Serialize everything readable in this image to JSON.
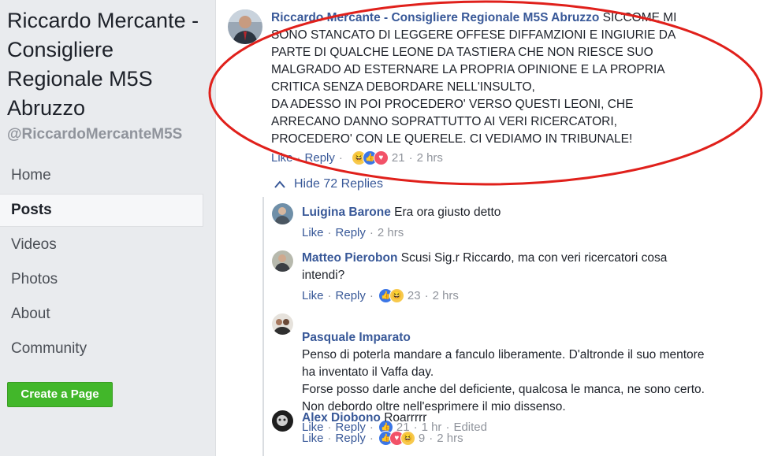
{
  "sidebar": {
    "page_name": "Riccardo Mercante - Consigliere Regionale M5S Abruzzo",
    "handle": "@RiccardoMercanteM5S",
    "nav": [
      "Home",
      "Posts",
      "Videos",
      "Photos",
      "About",
      "Community"
    ],
    "active_nav": "Posts",
    "create_page_label": "Create a Page"
  },
  "main_comment": {
    "author": "Riccardo Mercante - Consigliere Regionale M5S Abruzzo",
    "text_lines": [
      "SICCOME MI",
      "SONO STANCATO DI LEGGERE OFFESE DIFFAMZIONI E INGIURIE DA",
      "PARTE DI QUALCHE LEONE DA TASTIERA CHE NON RIESCE SUO",
      "MALGRADO AD ESTERNARE LA PROPRIA OPINIONE E LA PROPRIA",
      "CRITICA SENZA DEBORDARE NELL'INSULTO,",
      "DA ADESSO IN POI PROCEDERO' VERSO QUESTI LEONI, CHE",
      "ARRECANO DANNO SOPRATTUTTO AI VERI RICERCATORI,",
      "PROCEDERO' CON LE QUERELE. CI VEDIAMO IN TRIBUNALE!"
    ],
    "like_label": "Like",
    "reply_label": "Reply",
    "reactions": [
      "haha",
      "like",
      "love"
    ],
    "reaction_count": "21",
    "time": "2 hrs"
  },
  "hide_replies_label": "Hide 72 Replies",
  "replies": [
    {
      "author": "Luigina Barone",
      "text": "Era ora giusto detto",
      "like_label": "Like",
      "reply_label": "Reply",
      "reactions": [],
      "reaction_count": "",
      "time": "2 hrs",
      "edited": ""
    },
    {
      "author": "Matteo Pierobon",
      "text": "Scusi Sig.r Riccardo, ma con veri ricercatori cosa intendi?",
      "like_label": "Like",
      "reply_label": "Reply",
      "reactions": [
        "like",
        "haha"
      ],
      "reaction_count": "23",
      "time": "2 hrs",
      "edited": ""
    },
    {
      "author": "Pasquale Imparato",
      "text": "Penso di poterla mandare a fanculo liberamente. D'altronde il suo mentore ha inventato il Vaffa day.\nForse posso darle anche del deficiente, qualcosa le manca, ne sono certo. Non debordo oltre nell'esprimere il mio dissenso.",
      "like_label": "Like",
      "reply_label": "Reply",
      "reactions": [
        "like"
      ],
      "reaction_count": "21",
      "time": "1 hr",
      "edited": "Edited"
    },
    {
      "author": "Alex Diobono",
      "text": "Roarrrrr",
      "like_label": "Like",
      "reply_label": "Reply",
      "reactions": [
        "like",
        "love",
        "haha"
      ],
      "reaction_count": "9",
      "time": "2 hrs",
      "edited": ""
    }
  ],
  "colors": {
    "link": "#385898",
    "annotation_ellipse": "#e0201b",
    "create_button": "#42b72a"
  }
}
